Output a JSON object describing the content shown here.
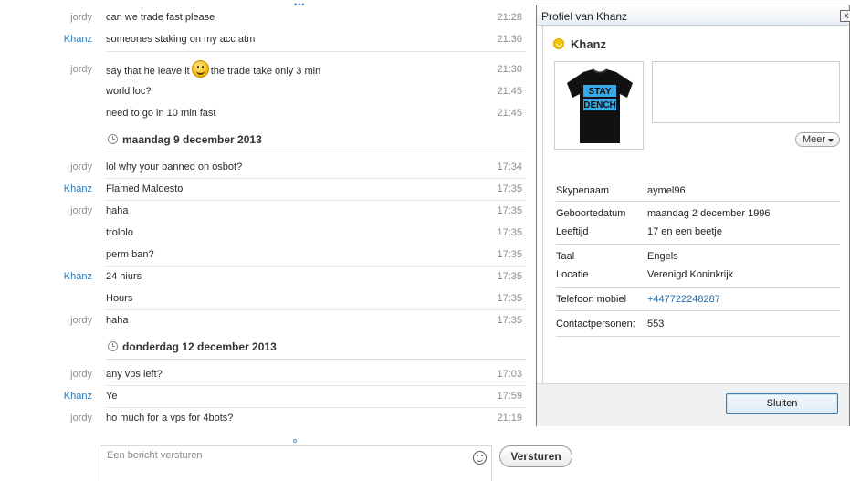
{
  "chat": {
    "messages": [
      {
        "sender": "jordy",
        "text": "can we trade fast please",
        "time": "21:28"
      },
      {
        "sender": "Khanz",
        "text": "someones staking on my acc atm",
        "time": "21:30"
      },
      {
        "sender": "jordy",
        "text_before": "say that he leave it",
        "emoticon": "smile",
        "text_after": "the trade take only 3 min",
        "time": "21:30"
      },
      {
        "sender": "",
        "text": "world loc?",
        "time": "21:45"
      },
      {
        "sender": "",
        "text": "need to go in 10 min fast",
        "time": "21:45"
      },
      {
        "sender": "jordy",
        "text": "lol why your banned on osbot?",
        "time": "17:34"
      },
      {
        "sender": "Khanz",
        "text": "Flamed Maldesto",
        "time": "17:35"
      },
      {
        "sender": "jordy",
        "text": "haha",
        "time": "17:35"
      },
      {
        "sender": "",
        "text": "trololo",
        "time": "17:35"
      },
      {
        "sender": "",
        "text": "perm ban?",
        "time": "17:35"
      },
      {
        "sender": "Khanz",
        "text": "24 hiurs",
        "time": "17:35"
      },
      {
        "sender": "",
        "text": "Hours",
        "time": "17:35"
      },
      {
        "sender": "jordy",
        "text": "haha",
        "time": "17:35"
      },
      {
        "sender": "jordy",
        "text": "any vps left?",
        "time": "17:03"
      },
      {
        "sender": "Khanz",
        "text": "Ye",
        "time": "17:59"
      },
      {
        "sender": "jordy",
        "text": "ho much for a vps for 4bots?",
        "time": "21:19"
      }
    ],
    "date_headers": [
      "maandag 9 december 2013",
      "donderdag 12 december 2013"
    ],
    "composer": {
      "placeholder": "Een bericht versturen",
      "value": "",
      "emoticon_icon": "smiley-icon",
      "send_label": "Versturen"
    }
  },
  "profile": {
    "window_title": "Profiel van Khanz",
    "close_glyph": "x",
    "name": "Khanz",
    "status_color": "#f4c400",
    "avatar": {
      "shirt_text_line1": "STAY",
      "shirt_text_line2": "DENCH",
      "shirt_text_color": "#3aa8e6"
    },
    "more_label": "Meer",
    "fields": {
      "skypename": {
        "label": "Skypenaam",
        "value": "aymel96"
      },
      "birthdate": {
        "label": "Geboortedatum",
        "value": "maandag 2 december 1996"
      },
      "age": {
        "label": "Leeftijd",
        "value": "17 en een beetje"
      },
      "language": {
        "label": "Taal",
        "value": "Engels"
      },
      "location": {
        "label": "Locatie",
        "value": "Verenigd Koninkrijk"
      },
      "phone": {
        "label": "Telefoon mobiel",
        "value": "+447722248287"
      },
      "contacts": {
        "label": "Contactpersonen:",
        "value": "553"
      }
    },
    "close_button_label": "Sluiten"
  },
  "colors": {
    "sender_jordy": "#8c8c8c",
    "sender_khanz": "#2a7ab8",
    "link": "#1d6fb3"
  }
}
